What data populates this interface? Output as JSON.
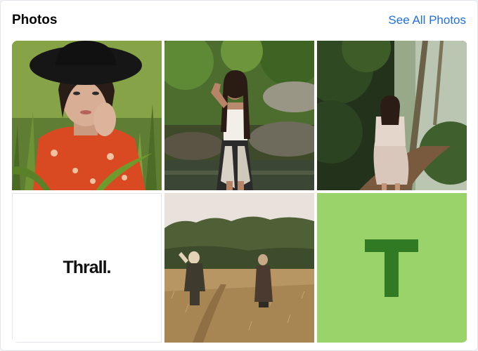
{
  "header": {
    "title": "Photos",
    "see_all_label": "See All Photos"
  },
  "photos": [
    {
      "kind": "photo",
      "subject": "woman in black hat and orange floral shirt among tall grass"
    },
    {
      "kind": "photo",
      "subject": "woman posing by stream with rocks and trees"
    },
    {
      "kind": "photo",
      "subject": "woman walking on forest trail"
    },
    {
      "kind": "logo",
      "text": "Thrall."
    },
    {
      "kind": "photo",
      "subject": "two women walking through wheat field"
    },
    {
      "kind": "letter-avatar",
      "letter": "T"
    }
  ],
  "colors": {
    "link": "#216fdb",
    "letter_tile_bg": "#99d36a",
    "letter_glyph": "#2f7a22"
  }
}
